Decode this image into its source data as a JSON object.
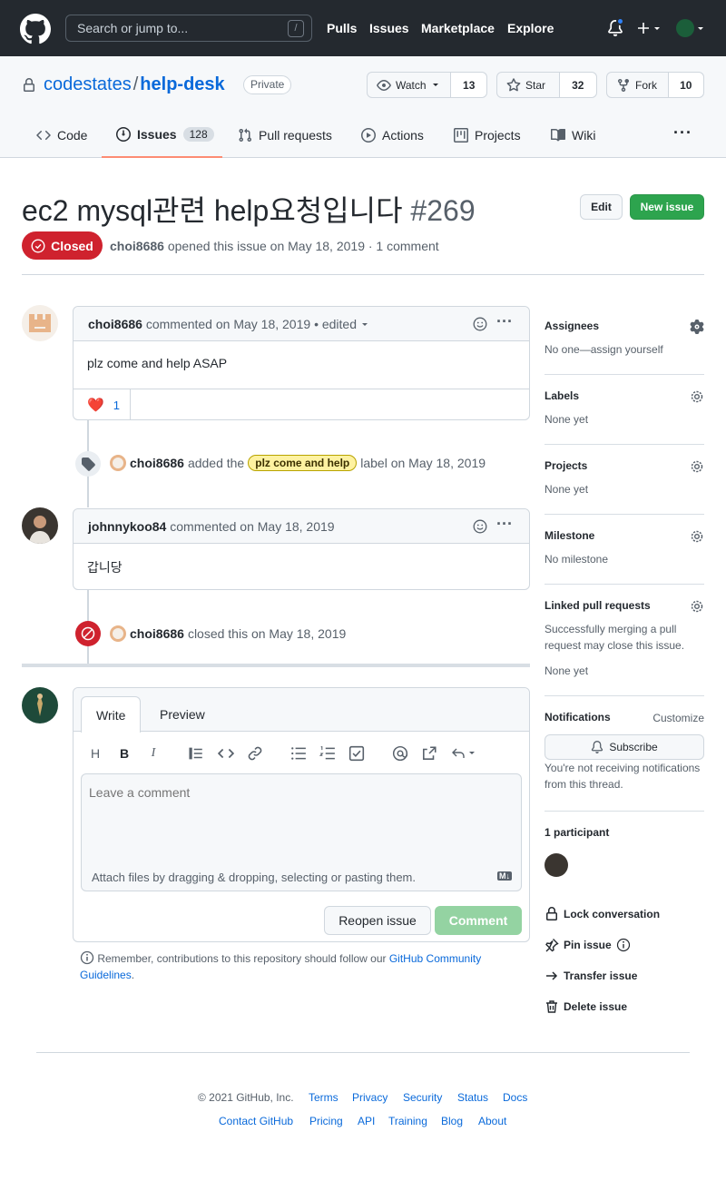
{
  "header": {
    "search_placeholder": "Search or jump to...",
    "search_shortcut": "/",
    "nav": [
      "Pulls",
      "Issues",
      "Marketplace",
      "Explore"
    ]
  },
  "repo": {
    "owner": "codestates",
    "separator": "/",
    "name": "help-desk",
    "visibility": "Private",
    "watch_label": "Watch",
    "watch_count": "13",
    "star_label": "Star",
    "star_count": "32",
    "fork_label": "Fork",
    "fork_count": "10",
    "tabs": [
      {
        "label": "Code"
      },
      {
        "label": "Issues",
        "count": "128"
      },
      {
        "label": "Pull requests"
      },
      {
        "label": "Actions"
      },
      {
        "label": "Projects"
      },
      {
        "label": "Wiki"
      }
    ],
    "more": "···"
  },
  "issue": {
    "title": "ec2 mysql관련 help요청입니다",
    "number": "#269",
    "edit_label": "Edit",
    "new_issue_label": "New issue",
    "status": "Closed",
    "author": "choi8686",
    "meta_text": "opened this issue on May 18, 2019 · 1 comment"
  },
  "timeline": {
    "comment1": {
      "author": "choi8686",
      "meta": "commented on May 18, 2019",
      "edited": "• edited",
      "body": "plz come and help ASAP",
      "reaction_emoji": "❤️",
      "reaction_count": "1"
    },
    "label_event": {
      "actor": "choi8686",
      "pre": "added the",
      "label": "plz come and help",
      "post": "label on May 18, 2019"
    },
    "comment2": {
      "author": "johnnykoo84",
      "meta": "commented on May 18, 2019",
      "body": "갑니당"
    },
    "close_event": {
      "actor": "choi8686",
      "text": "closed this on May 18, 2019"
    }
  },
  "composer": {
    "tab_write": "Write",
    "tab_preview": "Preview",
    "placeholder": "Leave a comment",
    "attach_text": "Attach files by dragging & dropping, selecting or pasting them.",
    "md_badge": "M↓",
    "reopen_label": "Reopen issue",
    "comment_label": "Comment",
    "guideline_pre": "Remember, contributions to this repository should follow our",
    "guideline_link": "GitHub Community Guidelines",
    "guideline_post": "."
  },
  "sidebar": {
    "assignees": {
      "title": "Assignees",
      "value": "No one—assign yourself"
    },
    "labels": {
      "title": "Labels",
      "value": "None yet"
    },
    "projects": {
      "title": "Projects",
      "value": "None yet"
    },
    "milestone": {
      "title": "Milestone",
      "value": "No milestone"
    },
    "linked_prs": {
      "title": "Linked pull requests",
      "desc": "Successfully merging a pull request may close this issue.",
      "value": "None yet"
    },
    "notifications": {
      "title": "Notifications",
      "customize": "Customize",
      "subscribe": "Subscribe",
      "desc": "You're not receiving notifications from this thread."
    },
    "participants": {
      "title": "1 participant"
    },
    "actions": [
      "Lock conversation",
      "Pin issue",
      "Transfer issue",
      "Delete issue"
    ]
  },
  "footer": {
    "copyright": "© 2021 GitHub, Inc.",
    "row1": [
      "Terms",
      "Privacy",
      "Security",
      "Status",
      "Docs"
    ],
    "row2": [
      "Contact GitHub",
      "Pricing",
      "API",
      "Training",
      "Blog",
      "About"
    ]
  },
  "colors": {
    "accent": "#0969da",
    "closed": "#cf222e",
    "success": "#2da44e",
    "label_bg": "#fef2a1"
  }
}
